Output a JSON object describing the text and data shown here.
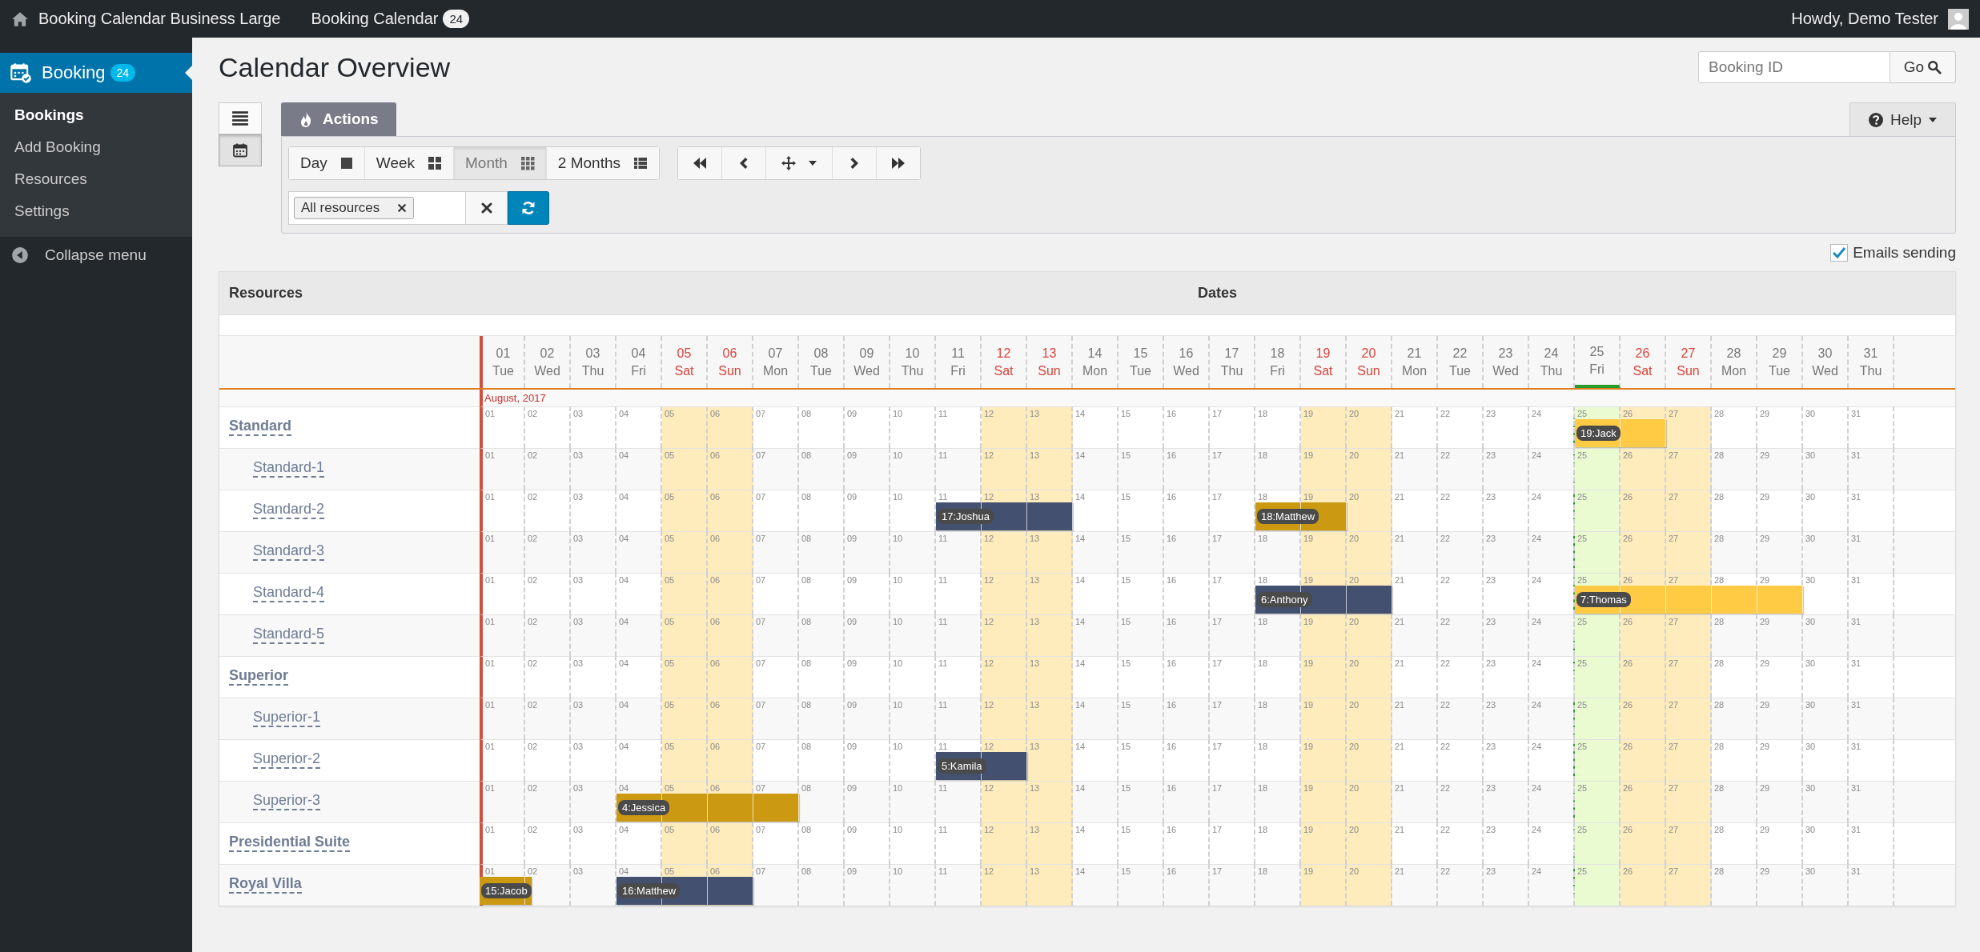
{
  "top_bar": {
    "site": "Booking Calendar Business Large",
    "plugin": "Booking Calendar",
    "plugin_count": "24",
    "greeting": "Howdy, Demo Tester"
  },
  "sidebar": {
    "menu": {
      "label": "Booking",
      "count": "24",
      "selected": true
    },
    "items": [
      {
        "label": "Bookings",
        "selected": true
      },
      {
        "label": "Add Booking",
        "selected": false
      },
      {
        "label": "Resources",
        "selected": false
      },
      {
        "label": "Settings",
        "selected": false
      }
    ],
    "collapse": "Collapse menu"
  },
  "page": {
    "title": "Calendar Overview",
    "search": {
      "placeholder": "Booking ID",
      "button": "Go"
    }
  },
  "view_toggle": [
    {
      "kind": "list",
      "selected": false
    },
    {
      "kind": "calendar",
      "selected": true
    }
  ],
  "tabs": {
    "actions": "Actions",
    "help": "Help"
  },
  "view_modes": [
    {
      "label": "Day",
      "kind": "day",
      "selected": false
    },
    {
      "label": "Week",
      "kind": "week",
      "selected": false
    },
    {
      "label": "Month",
      "kind": "month",
      "selected": true
    },
    {
      "label": "2 Months",
      "kind": "two-months",
      "selected": false
    }
  ],
  "filter": {
    "chip": "All resources"
  },
  "emails_sending": {
    "label": "Emails sending",
    "checked": true
  },
  "calendar": {
    "columns": {
      "resources": "Resources",
      "dates": "Dates"
    },
    "month": "August, 2017",
    "days": [
      {
        "num": "01",
        "dow": "Tue",
        "weekend": false,
        "today": false
      },
      {
        "num": "02",
        "dow": "Wed",
        "weekend": false,
        "today": false
      },
      {
        "num": "03",
        "dow": "Thu",
        "weekend": false,
        "today": false
      },
      {
        "num": "04",
        "dow": "Fri",
        "weekend": false,
        "today": false
      },
      {
        "num": "05",
        "dow": "Sat",
        "weekend": true,
        "today": false
      },
      {
        "num": "06",
        "dow": "Sun",
        "weekend": true,
        "today": false
      },
      {
        "num": "07",
        "dow": "Mon",
        "weekend": false,
        "today": false
      },
      {
        "num": "08",
        "dow": "Tue",
        "weekend": false,
        "today": false
      },
      {
        "num": "09",
        "dow": "Wed",
        "weekend": false,
        "today": false
      },
      {
        "num": "10",
        "dow": "Thu",
        "weekend": false,
        "today": false
      },
      {
        "num": "11",
        "dow": "Fri",
        "weekend": false,
        "today": false
      },
      {
        "num": "12",
        "dow": "Sat",
        "weekend": true,
        "today": false
      },
      {
        "num": "13",
        "dow": "Sun",
        "weekend": true,
        "today": false
      },
      {
        "num": "14",
        "dow": "Mon",
        "weekend": false,
        "today": false
      },
      {
        "num": "15",
        "dow": "Tue",
        "weekend": false,
        "today": false
      },
      {
        "num": "16",
        "dow": "Wed",
        "weekend": false,
        "today": false
      },
      {
        "num": "17",
        "dow": "Thu",
        "weekend": false,
        "today": false
      },
      {
        "num": "18",
        "dow": "Fri",
        "weekend": false,
        "today": false
      },
      {
        "num": "19",
        "dow": "Sat",
        "weekend": true,
        "today": false
      },
      {
        "num": "20",
        "dow": "Sun",
        "weekend": true,
        "today": false
      },
      {
        "num": "21",
        "dow": "Mon",
        "weekend": false,
        "today": false
      },
      {
        "num": "22",
        "dow": "Tue",
        "weekend": false,
        "today": false
      },
      {
        "num": "23",
        "dow": "Wed",
        "weekend": false,
        "today": false
      },
      {
        "num": "24",
        "dow": "Thu",
        "weekend": false,
        "today": false
      },
      {
        "num": "25",
        "dow": "Fri",
        "weekend": false,
        "today": true
      },
      {
        "num": "26",
        "dow": "Sat",
        "weekend": true,
        "today": false
      },
      {
        "num": "27",
        "dow": "Sun",
        "weekend": true,
        "today": false
      },
      {
        "num": "28",
        "dow": "Mon",
        "weekend": false,
        "today": false
      },
      {
        "num": "29",
        "dow": "Tue",
        "weekend": false,
        "today": false
      },
      {
        "num": "30",
        "dow": "Wed",
        "weekend": false,
        "today": false
      },
      {
        "num": "31",
        "dow": "Thu",
        "weekend": false,
        "today": false
      }
    ],
    "rows": [
      {
        "name": "Standard",
        "kind": "group",
        "cells": [
          {
            "n": "01"
          },
          {
            "n": "02"
          },
          {
            "n": "03"
          },
          {
            "n": "04"
          },
          {
            "n": "05"
          },
          {
            "n": "06"
          },
          {
            "n": "07"
          },
          {
            "n": "08"
          },
          {
            "n": "09"
          },
          {
            "n": "10"
          },
          {
            "n": "11"
          },
          {
            "n": "12"
          },
          {
            "n": "13"
          },
          {
            "n": "14"
          },
          {
            "n": "15"
          },
          {
            "n": "16"
          },
          {
            "n": "17"
          },
          {
            "n": "18"
          },
          {
            "n": "19"
          },
          {
            "n": "20"
          },
          {
            "n": "21"
          },
          {
            "n": "22"
          },
          {
            "n": "23"
          },
          {
            "n": "24"
          },
          {
            "n": "25",
            "color": "#ffcb44",
            "label": "19:Jack"
          },
          {
            "n": "26",
            "color": "#ffcb44"
          },
          {
            "n": "27"
          },
          {
            "n": "28"
          },
          {
            "n": "29"
          },
          {
            "n": "30"
          },
          {
            "n": "31"
          }
        ]
      },
      {
        "name": "Standard-1",
        "kind": "item",
        "cells": [
          {
            "n": "01"
          },
          {
            "n": "02"
          },
          {
            "n": "03"
          },
          {
            "n": "04"
          },
          {
            "n": "05"
          },
          {
            "n": "06"
          },
          {
            "n": "07"
          },
          {
            "n": "08"
          },
          {
            "n": "09"
          },
          {
            "n": "10"
          },
          {
            "n": "11"
          },
          {
            "n": "12"
          },
          {
            "n": "13"
          },
          {
            "n": "14"
          },
          {
            "n": "15"
          },
          {
            "n": "16"
          },
          {
            "n": "17"
          },
          {
            "n": "18"
          },
          {
            "n": "19"
          },
          {
            "n": "20"
          },
          {
            "n": "21"
          },
          {
            "n": "22"
          },
          {
            "n": "23"
          },
          {
            "n": "24"
          },
          {
            "n": "25"
          },
          {
            "n": "26"
          },
          {
            "n": "27"
          },
          {
            "n": "28"
          },
          {
            "n": "29"
          },
          {
            "n": "30"
          },
          {
            "n": "31"
          }
        ]
      },
      {
        "name": "Standard-2",
        "kind": "item",
        "cells": [
          {
            "n": "01"
          },
          {
            "n": "02"
          },
          {
            "n": "03"
          },
          {
            "n": "04"
          },
          {
            "n": "05"
          },
          {
            "n": "06"
          },
          {
            "n": "07"
          },
          {
            "n": "08"
          },
          {
            "n": "09"
          },
          {
            "n": "10"
          },
          {
            "n": "11",
            "color": "#44506f",
            "label": "17:Joshua"
          },
          {
            "n": "12",
            "color": "#44506f"
          },
          {
            "n": "13",
            "color": "#44506f"
          },
          {
            "n": "14"
          },
          {
            "n": "15"
          },
          {
            "n": "16"
          },
          {
            "n": "17"
          },
          {
            "n": "18",
            "color": "#cc9912",
            "label": "18:Matthew"
          },
          {
            "n": "19",
            "color": "#cc9912"
          },
          {
            "n": "20"
          },
          {
            "n": "21"
          },
          {
            "n": "22"
          },
          {
            "n": "23"
          },
          {
            "n": "24"
          },
          {
            "n": "25"
          },
          {
            "n": "26"
          },
          {
            "n": "27"
          },
          {
            "n": "28"
          },
          {
            "n": "29"
          },
          {
            "n": "30"
          },
          {
            "n": "31"
          }
        ]
      },
      {
        "name": "Standard-3",
        "kind": "item",
        "cells": [
          {
            "n": "01"
          },
          {
            "n": "02"
          },
          {
            "n": "03"
          },
          {
            "n": "04"
          },
          {
            "n": "05"
          },
          {
            "n": "06"
          },
          {
            "n": "07"
          },
          {
            "n": "08"
          },
          {
            "n": "09"
          },
          {
            "n": "10"
          },
          {
            "n": "11"
          },
          {
            "n": "12"
          },
          {
            "n": "13"
          },
          {
            "n": "14"
          },
          {
            "n": "15"
          },
          {
            "n": "16"
          },
          {
            "n": "17"
          },
          {
            "n": "18"
          },
          {
            "n": "19"
          },
          {
            "n": "20"
          },
          {
            "n": "21"
          },
          {
            "n": "22"
          },
          {
            "n": "23"
          },
          {
            "n": "24"
          },
          {
            "n": "25"
          },
          {
            "n": "26"
          },
          {
            "n": "27"
          },
          {
            "n": "28"
          },
          {
            "n": "29"
          },
          {
            "n": "30"
          },
          {
            "n": "31"
          }
        ]
      },
      {
        "name": "Standard-4",
        "kind": "item",
        "cells": [
          {
            "n": "01"
          },
          {
            "n": "02"
          },
          {
            "n": "03"
          },
          {
            "n": "04"
          },
          {
            "n": "05"
          },
          {
            "n": "06"
          },
          {
            "n": "07"
          },
          {
            "n": "08"
          },
          {
            "n": "09"
          },
          {
            "n": "10"
          },
          {
            "n": "11"
          },
          {
            "n": "12"
          },
          {
            "n": "13"
          },
          {
            "n": "14"
          },
          {
            "n": "15"
          },
          {
            "n": "16"
          },
          {
            "n": "17"
          },
          {
            "n": "18",
            "color": "#44506f",
            "label": "6:Anthony"
          },
          {
            "n": "19",
            "color": "#44506f"
          },
          {
            "n": "20",
            "color": "#44506f"
          },
          {
            "n": "21"
          },
          {
            "n": "22"
          },
          {
            "n": "23"
          },
          {
            "n": "24"
          },
          {
            "n": "25",
            "color": "#ffcb44",
            "label": "7:Thomas"
          },
          {
            "n": "26",
            "color": "#ffcb44"
          },
          {
            "n": "27",
            "color": "#ffcb44"
          },
          {
            "n": "28",
            "color": "#ffcb44"
          },
          {
            "n": "29",
            "color": "#ffcb44"
          },
          {
            "n": "30"
          },
          {
            "n": "31"
          }
        ]
      },
      {
        "name": "Standard-5",
        "kind": "item",
        "cells": [
          {
            "n": "01"
          },
          {
            "n": "02"
          },
          {
            "n": "03"
          },
          {
            "n": "04"
          },
          {
            "n": "05"
          },
          {
            "n": "06"
          },
          {
            "n": "07"
          },
          {
            "n": "08"
          },
          {
            "n": "09"
          },
          {
            "n": "10"
          },
          {
            "n": "11"
          },
          {
            "n": "12"
          },
          {
            "n": "13"
          },
          {
            "n": "14"
          },
          {
            "n": "15"
          },
          {
            "n": "16"
          },
          {
            "n": "17"
          },
          {
            "n": "18"
          },
          {
            "n": "19"
          },
          {
            "n": "20"
          },
          {
            "n": "21"
          },
          {
            "n": "22"
          },
          {
            "n": "23"
          },
          {
            "n": "24"
          },
          {
            "n": "25"
          },
          {
            "n": "26"
          },
          {
            "n": "27"
          },
          {
            "n": "28"
          },
          {
            "n": "29"
          },
          {
            "n": "30"
          },
          {
            "n": "31"
          }
        ]
      },
      {
        "name": "Superior",
        "kind": "group",
        "cells": [
          {
            "n": "01"
          },
          {
            "n": "02"
          },
          {
            "n": "03"
          },
          {
            "n": "04"
          },
          {
            "n": "05"
          },
          {
            "n": "06"
          },
          {
            "n": "07"
          },
          {
            "n": "08"
          },
          {
            "n": "09"
          },
          {
            "n": "10"
          },
          {
            "n": "11"
          },
          {
            "n": "12"
          },
          {
            "n": "13"
          },
          {
            "n": "14"
          },
          {
            "n": "15"
          },
          {
            "n": "16"
          },
          {
            "n": "17"
          },
          {
            "n": "18"
          },
          {
            "n": "19"
          },
          {
            "n": "20"
          },
          {
            "n": "21"
          },
          {
            "n": "22"
          },
          {
            "n": "23"
          },
          {
            "n": "24"
          },
          {
            "n": "25"
          },
          {
            "n": "26"
          },
          {
            "n": "27"
          },
          {
            "n": "28"
          },
          {
            "n": "29"
          },
          {
            "n": "30"
          },
          {
            "n": "31"
          }
        ]
      },
      {
        "name": "Superior-1",
        "kind": "item",
        "cells": [
          {
            "n": "01"
          },
          {
            "n": "02"
          },
          {
            "n": "03"
          },
          {
            "n": "04"
          },
          {
            "n": "05"
          },
          {
            "n": "06"
          },
          {
            "n": "07"
          },
          {
            "n": "08"
          },
          {
            "n": "09"
          },
          {
            "n": "10"
          },
          {
            "n": "11"
          },
          {
            "n": "12"
          },
          {
            "n": "13"
          },
          {
            "n": "14"
          },
          {
            "n": "15"
          },
          {
            "n": "16"
          },
          {
            "n": "17"
          },
          {
            "n": "18"
          },
          {
            "n": "19"
          },
          {
            "n": "20"
          },
          {
            "n": "21"
          },
          {
            "n": "22"
          },
          {
            "n": "23"
          },
          {
            "n": "24"
          },
          {
            "n": "25"
          },
          {
            "n": "26"
          },
          {
            "n": "27"
          },
          {
            "n": "28"
          },
          {
            "n": "29"
          },
          {
            "n": "30"
          },
          {
            "n": "31"
          }
        ]
      },
      {
        "name": "Superior-2",
        "kind": "item",
        "cells": [
          {
            "n": "01"
          },
          {
            "n": "02"
          },
          {
            "n": "03"
          },
          {
            "n": "04"
          },
          {
            "n": "05"
          },
          {
            "n": "06"
          },
          {
            "n": "07"
          },
          {
            "n": "08"
          },
          {
            "n": "09"
          },
          {
            "n": "10"
          },
          {
            "n": "11",
            "color": "#44506f",
            "label": "5:Kamila"
          },
          {
            "n": "12",
            "color": "#44506f"
          },
          {
            "n": "13"
          },
          {
            "n": "14"
          },
          {
            "n": "15"
          },
          {
            "n": "16"
          },
          {
            "n": "17"
          },
          {
            "n": "18"
          },
          {
            "n": "19"
          },
          {
            "n": "20"
          },
          {
            "n": "21"
          },
          {
            "n": "22"
          },
          {
            "n": "23"
          },
          {
            "n": "24"
          },
          {
            "n": "25"
          },
          {
            "n": "26"
          },
          {
            "n": "27"
          },
          {
            "n": "28"
          },
          {
            "n": "29"
          },
          {
            "n": "30"
          },
          {
            "n": "31"
          }
        ]
      },
      {
        "name": "Superior-3",
        "kind": "item",
        "cells": [
          {
            "n": "01"
          },
          {
            "n": "02"
          },
          {
            "n": "03"
          },
          {
            "n": "04",
            "color": "#cc9912",
            "label": "4:Jessica"
          },
          {
            "n": "05",
            "color": "#cc9912"
          },
          {
            "n": "06",
            "color": "#cc9912"
          },
          {
            "n": "07",
            "color": "#cc9912"
          },
          {
            "n": "08"
          },
          {
            "n": "09"
          },
          {
            "n": "10"
          },
          {
            "n": "11"
          },
          {
            "n": "12"
          },
          {
            "n": "13"
          },
          {
            "n": "14"
          },
          {
            "n": "15"
          },
          {
            "n": "16"
          },
          {
            "n": "17"
          },
          {
            "n": "18"
          },
          {
            "n": "19"
          },
          {
            "n": "20"
          },
          {
            "n": "21"
          },
          {
            "n": "22"
          },
          {
            "n": "23"
          },
          {
            "n": "24"
          },
          {
            "n": "25"
          },
          {
            "n": "26"
          },
          {
            "n": "27"
          },
          {
            "n": "28"
          },
          {
            "n": "29"
          },
          {
            "n": "30"
          },
          {
            "n": "31"
          }
        ]
      },
      {
        "name": "Presidential Suite",
        "kind": "group",
        "cells": [
          {
            "n": "01"
          },
          {
            "n": "02"
          },
          {
            "n": "03"
          },
          {
            "n": "04"
          },
          {
            "n": "05"
          },
          {
            "n": "06"
          },
          {
            "n": "07"
          },
          {
            "n": "08"
          },
          {
            "n": "09"
          },
          {
            "n": "10"
          },
          {
            "n": "11"
          },
          {
            "n": "12"
          },
          {
            "n": "13"
          },
          {
            "n": "14"
          },
          {
            "n": "15"
          },
          {
            "n": "16"
          },
          {
            "n": "17"
          },
          {
            "n": "18"
          },
          {
            "n": "19"
          },
          {
            "n": "20"
          },
          {
            "n": "21"
          },
          {
            "n": "22"
          },
          {
            "n": "23"
          },
          {
            "n": "24"
          },
          {
            "n": "25"
          },
          {
            "n": "26"
          },
          {
            "n": "27"
          },
          {
            "n": "28"
          },
          {
            "n": "29"
          },
          {
            "n": "30"
          },
          {
            "n": "31"
          }
        ]
      },
      {
        "name": "Royal Villa",
        "kind": "group",
        "cells": [
          {
            "n": "01",
            "color": "#cc9912",
            "label": "15:Jacob"
          },
          {
            "n": "02"
          },
          {
            "n": "03"
          },
          {
            "n": "04",
            "color": "#44506f",
            "label": "16:Matthew"
          },
          {
            "n": "05",
            "color": "#44506f"
          },
          {
            "n": "06",
            "color": "#44506f"
          },
          {
            "n": "07"
          },
          {
            "n": "08"
          },
          {
            "n": "09"
          },
          {
            "n": "10"
          },
          {
            "n": "11"
          },
          {
            "n": "12"
          },
          {
            "n": "13"
          },
          {
            "n": "14"
          },
          {
            "n": "15"
          },
          {
            "n": "16"
          },
          {
            "n": "17"
          },
          {
            "n": "18"
          },
          {
            "n": "19"
          },
          {
            "n": "20"
          },
          {
            "n": "21"
          },
          {
            "n": "22"
          },
          {
            "n": "23"
          },
          {
            "n": "24"
          },
          {
            "n": "25"
          },
          {
            "n": "26"
          },
          {
            "n": "27"
          },
          {
            "n": "28"
          },
          {
            "n": "29"
          },
          {
            "n": "30"
          },
          {
            "n": "31"
          }
        ]
      }
    ]
  }
}
